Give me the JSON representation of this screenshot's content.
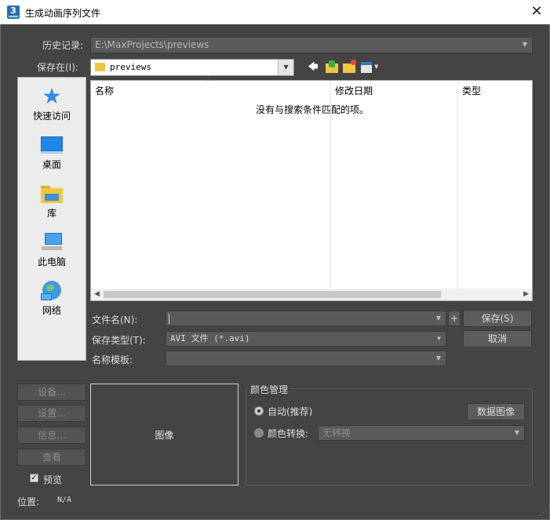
{
  "window": {
    "title": "生成动画序列文件",
    "close_glyph": "✕",
    "app_icon_text": "3"
  },
  "history": {
    "label": "历史记录:",
    "value": "E:\\MaxProjects\\previews"
  },
  "save_in": {
    "label": "保存在(I):",
    "value": "previews"
  },
  "places": [
    {
      "label": "快速访问",
      "icon": "star-icon"
    },
    {
      "label": "桌面",
      "icon": "desktop-icon"
    },
    {
      "label": "库",
      "icon": "library-folder-icon"
    },
    {
      "label": "此电脑",
      "icon": "computer-icon"
    },
    {
      "label": "网络",
      "icon": "network-icon"
    }
  ],
  "filelist": {
    "columns": [
      "名称",
      "修改日期",
      "类型"
    ],
    "empty_message": "没有与搜索条件匹配的项。",
    "sort_glyph": "^"
  },
  "filename": {
    "label": "文件名(N):",
    "value": ""
  },
  "filetype": {
    "label": "保存类型(T):",
    "value": "AVI 文件 (*.avi)"
  },
  "name_template": {
    "label": "名称模板:",
    "value": ""
  },
  "buttons": {
    "plus": "+",
    "save": "保存(S)",
    "cancel": "取消"
  },
  "side_buttons": {
    "setup1": "设备...",
    "setup2": "设置...",
    "info": "信息...",
    "view": "查看"
  },
  "preview_checkbox": {
    "label": "预览",
    "checked": true
  },
  "location": {
    "label": "位置:",
    "value": "N/A"
  },
  "image_box": {
    "label": "图像"
  },
  "color_mgmt": {
    "title": "颜色管理",
    "auto_label": "自动(推荐)",
    "data_image_button": "数据图像",
    "convert_label": "颜色转换:",
    "convert_value": "无转换"
  },
  "colors": {
    "background": "#444444",
    "accent_blue": "#2a6fb0",
    "folder_yellow": "#f4c542"
  }
}
